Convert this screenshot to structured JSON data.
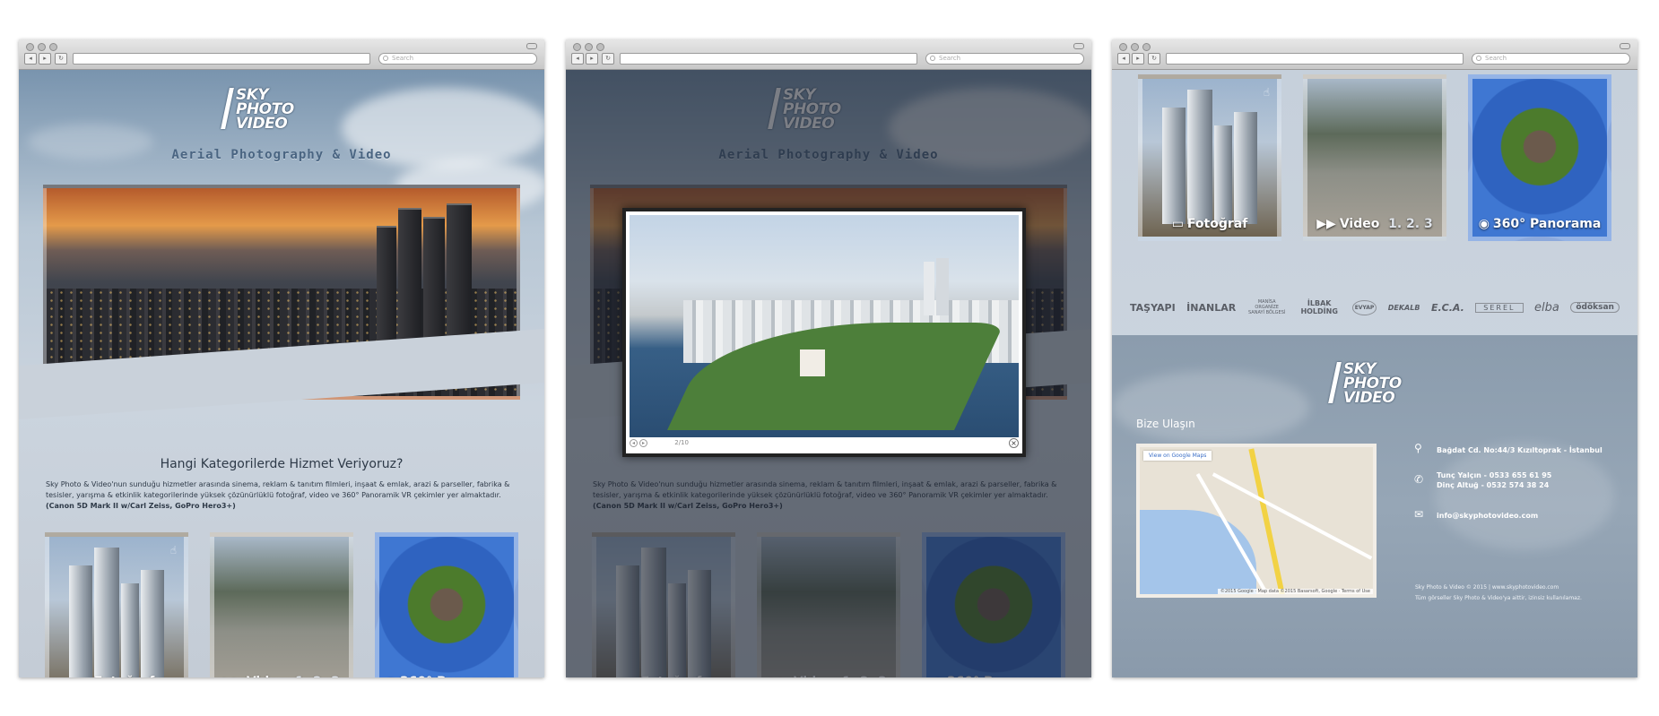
{
  "browser": {
    "search_placeholder": "Search",
    "back": "◂",
    "forward": "▸",
    "reload": "↻"
  },
  "brand": {
    "logo_lines": [
      "SKY",
      "PHOTO",
      "VIDEO"
    ],
    "tagline": "Aerial Photography & Video"
  },
  "intro": {
    "heading": "Hangi Kategorilerde Hizmet Veriyoruz?",
    "text": "Sky Photo & Video'nun sunduğu hizmetler arasında sinema, reklam & tanıtım filmleri, inşaat & emlak, arazi & parseller, fabrika & tesisler, yarışma & etkinlik kategorilerinde yüksek çözünürlüklü fotoğraf, video ve 360° Panoramik VR çekimler yer almaktadır.",
    "gear": "(Canon 5D Mark II w/Carl Zeiss, GoPro Hero3+)"
  },
  "categories": [
    {
      "icon": "▭",
      "label": "Fotoğraf"
    },
    {
      "icon": "▶▶",
      "label": "Video",
      "extra": "1. 2. 3"
    },
    {
      "icon": "◉",
      "label": "360° Panorama"
    }
  ],
  "lightbox": {
    "counter": "2/10",
    "close": "×",
    "prev": "◂",
    "next": "▸"
  },
  "clients": [
    "TAŞYAPI",
    "İNANLAR",
    "MANİSA ORGANİZE SANAYİ BÖLGESİ",
    "İLBAK HOLDİNG",
    "EVYAP",
    "DEKALB",
    "E.C.A.",
    "SEREL",
    "elba",
    "ödöksan"
  ],
  "contact": {
    "title": "Bize Ulaşın",
    "map_link": "View on Google Maps",
    "map_credit": "©2015 Google · Map data ©2015 Basarsoft, Google · Terms of Use",
    "address": "Bağdat Cd. No:44/3 Kızıltoprak - İstanbul",
    "phones": [
      "Tunç Yalçın - 0533 655 61 95",
      "Dinç Altuğ - 0532 574 38 24"
    ],
    "email": "info@skyphotovideo.com",
    "copyright": "Sky Photo & Video © 2015 | www.skyphotovideo.com",
    "rights": "Tüm görseller Sky Photo & Video'ya aittir, izinsiz kullanılamaz."
  },
  "colors": {
    "accent": "#4a6582",
    "footer": "#8b9cad"
  }
}
